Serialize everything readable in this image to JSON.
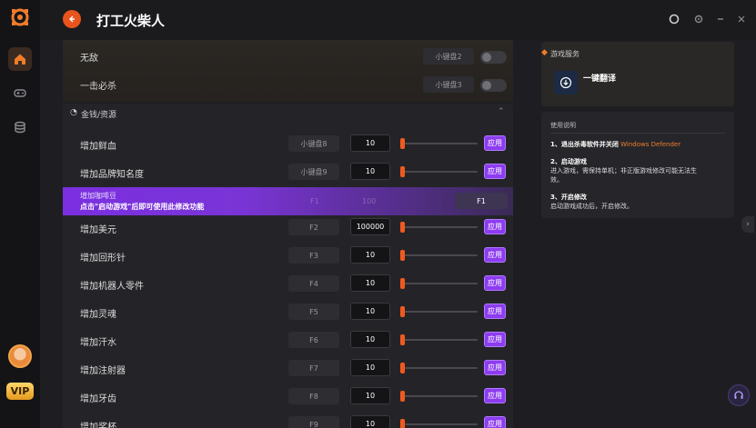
{
  "app": {
    "title": "打工火柴人",
    "vip_label": "VIP"
  },
  "top_rows": [
    {
      "label": "无敌",
      "hotkey": "小键盘2"
    },
    {
      "label": "一击必杀",
      "hotkey": "小键盘3"
    }
  ],
  "section": {
    "label": "金钱/资源"
  },
  "rows": [
    {
      "label": "增加鲜血",
      "hotkey": "小键盘8",
      "value": "10",
      "apply": "应用"
    },
    {
      "label": "增加品牌知名度",
      "hotkey": "小键盘9",
      "value": "10",
      "apply": "应用"
    }
  ],
  "highlight_row": {
    "label": "增加咖啡豆",
    "notice": "点击\"启动游戏\"后即可使用此修改功能",
    "hotkey_ghost": "F1",
    "value_ghost": "100",
    "hotkey": "F1"
  },
  "rows2": [
    {
      "label": "增加美元",
      "hotkey": "F2",
      "value": "100000",
      "apply": "应用"
    },
    {
      "label": "增加回形针",
      "hotkey": "F3",
      "value": "10",
      "apply": "应用"
    },
    {
      "label": "增加机器人零件",
      "hotkey": "F4",
      "value": "10",
      "apply": "应用"
    },
    {
      "label": "增加灵魂",
      "hotkey": "F5",
      "value": "10",
      "apply": "应用"
    },
    {
      "label": "增加汗水",
      "hotkey": "F6",
      "value": "10",
      "apply": "应用"
    },
    {
      "label": "增加注射器",
      "hotkey": "F7",
      "value": "10",
      "apply": "应用"
    },
    {
      "label": "增加牙齿",
      "hotkey": "F8",
      "value": "10",
      "apply": "应用"
    },
    {
      "label": "增加奖杯",
      "hotkey": "F9",
      "value": "10",
      "apply": "应用"
    }
  ],
  "right_panel": {
    "service_header": "游戏服务",
    "translate_label": "一键翻译",
    "info_header": "使用说明",
    "step1_prefix": "1、退出杀毒软件并关闭",
    "step1_accent": "Windows Defender",
    "step2_title": "2、启动游戏",
    "step2_line1": "进入游戏，需保持单机；非正版游戏修改可能无法生",
    "step2_line2": "效。",
    "step3_title": "3、开启修改",
    "step3_line1": "启动游戏成功后，开启修改。"
  },
  "colors": {
    "accent_orange": "#f05a1e",
    "apply_purple": "#8d3cf0",
    "highlight_purple": "#7b2fe0"
  }
}
